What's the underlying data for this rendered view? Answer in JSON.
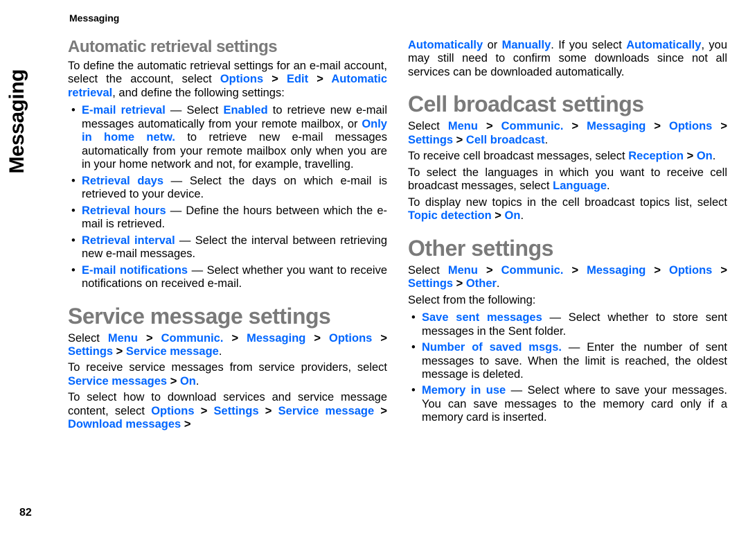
{
  "running_header": "Messaging",
  "side_label": "Messaging",
  "page_number": "82",
  "col1": {
    "h_sub1": "Automatic retrieval settings",
    "p_intro_1a": "To define the automatic retrieval settings for an e-mail account, select the account, select ",
    "p_intro_opt": "Options",
    "p_intro_gt1": " > ",
    "p_intro_edit": "Edit",
    "p_intro_gt2": " > ",
    "p_intro_auto": "Automatic retrieval",
    "p_intro_1b": ", and define the following settings:",
    "li1_kw": "E-mail retrieval",
    "li1_a": " — Select ",
    "li1_kw2": "Enabled",
    "li1_b": " to retrieve new e-mail messages automatically from your remote mailbox, or ",
    "li1_kw3": "Only in home netw.",
    "li1_c": " to retrieve new e-mail messages automatically from your remote mailbox only when you are in your home network and not, for example, travelling.",
    "li2_kw": "Retrieval days",
    "li2_a": " — Select the days on which e-mail is retrieved to your device.",
    "li3_kw": "Retrieval hours",
    "li3_a": " — Define the hours between which the e-mail is retrieved.",
    "li4_kw": "Retrieval interval",
    "li4_a": " — Select the interval between retrieving new e-mail messages.",
    "li5_kw": "E-mail notifications",
    "li5_a": " — Select whether you want to receive notifications on received e-mail.",
    "h_sect1": "Service message settings",
    "sm_a": "Select ",
    "sm_menu": "Menu",
    "sm_gt1": " > ",
    "sm_comm": "Communic.",
    "sm_gt2": " > ",
    "sm_msg": "Messaging",
    "sm_gt3": " > ",
    "sm_opt": "Options",
    "sm_gt4": " > ",
    "sm_set": "Settings",
    "sm_gt5": " > ",
    "sm_svc": "Service message",
    "sm_end": ".",
    "sm_p2a": "To receive service messages from service providers, select ",
    "sm_p2kw": "Service messages",
    "sm_p2gt": " > ",
    "sm_p2on": "On",
    "sm_p2end": ".",
    "sm_p3a": "To select how to download services and service message content, select ",
    "sm_p3opt": "Options",
    "sm_p3gt1": " > ",
    "sm_p3set": "Settings",
    "sm_p3gt2": " > ",
    "sm_p3svc": "Service message",
    "sm_p3gt3": " > ",
    "sm_p3dl": "Download messages",
    "sm_p3gt4": " > "
  },
  "col2": {
    "top_auto": "Automatically",
    "top_or": " or ",
    "top_man": "Manually",
    "top_a": ". If you select ",
    "top_auto2": "Automatically",
    "top_b": ", you may still need to confirm some downloads since not all services can be downloaded automatically.",
    "h_sect_cb": "Cell broadcast settings",
    "cb_a": "Select ",
    "cb_menu": "Menu",
    "cb_gt1": " > ",
    "cb_comm": "Communic.",
    "cb_gt2": " > ",
    "cb_msg": "Messaging",
    "cb_gt3": " > ",
    "cb_opt": "Options",
    "cb_gt4": " > ",
    "cb_set": "Settings",
    "cb_gt5": " > ",
    "cb_cb": "Cell broadcast",
    "cb_end": ".",
    "cb_p2a": "To receive cell broadcast messages, select ",
    "cb_p2kw": "Reception",
    "cb_p2gt": " > ",
    "cb_p2on": "On",
    "cb_p2end": ".",
    "cb_p3a": "To select the languages in which you want to receive cell broadcast messages, select ",
    "cb_p3kw": "Language",
    "cb_p3end": ".",
    "cb_p4a": "To display new topics in the cell broadcast topics list, select ",
    "cb_p4kw": "Topic detection",
    "cb_p4gt": " > ",
    "cb_p4on": "On",
    "cb_p4end": ".",
    "h_sect_oth": "Other settings",
    "oth_a": "Select ",
    "oth_menu": "Menu",
    "oth_gt1": " > ",
    "oth_comm": "Communic.",
    "oth_gt2": " > ",
    "oth_msg": "Messaging",
    "oth_gt3": " > ",
    "oth_opt": "Options",
    "oth_gt4": " > ",
    "oth_set": "Settings",
    "oth_gt5": " > ",
    "oth_other": "Other",
    "oth_end": ".",
    "oth_p2": "Select from the following:",
    "oli1_kw": "Save sent messages ",
    "oli1_a": " — Select whether to store sent messages in the Sent folder.",
    "oli2_kw": "Number of saved msgs. ",
    "oli2_a": " — Enter the number of sent messages to save. When the limit is reached, the oldest message is deleted.",
    "oli3_kw": "Memory in use ",
    "oli3_a": " — Select where to save your messages. You can save messages to the memory card only if a memory card is inserted."
  }
}
